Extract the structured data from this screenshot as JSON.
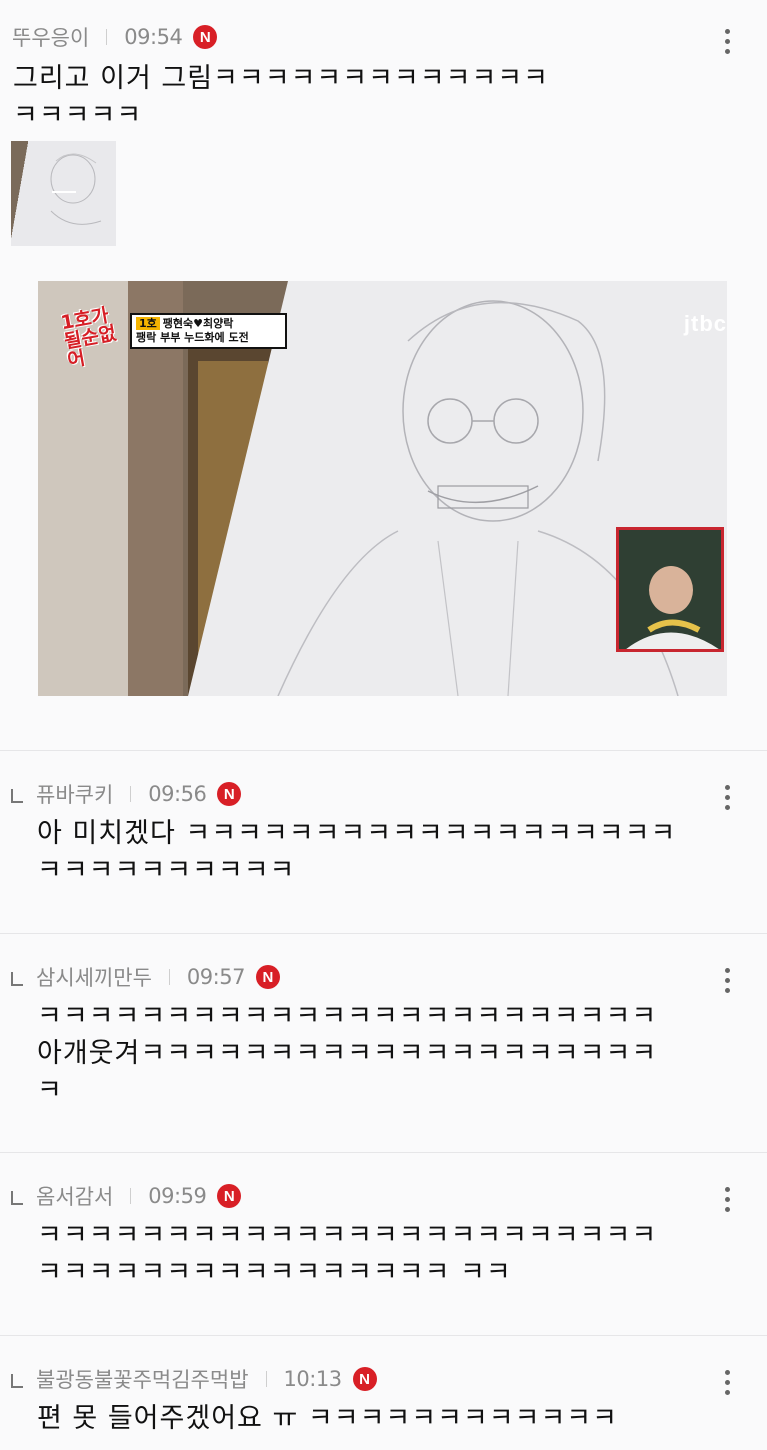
{
  "comments": [
    {
      "author": "뚜우응이",
      "time": "09:54",
      "badge": "N",
      "text": "그리고 이거 그림ㅋㅋㅋㅋㅋㅋㅋㅋㅋㅋㅋㅋㅋ\nㅋㅋㅋㅋㅋ",
      "reply": false
    },
    {
      "author": "퓨바쿠키",
      "time": "09:56",
      "badge": "N",
      "text": "아 미치겠다 ㅋㅋㅋㅋㅋㅋㅋㅋㅋㅋㅋㅋㅋㅋㅋㅋㅋㅋㅋ\nㅋㅋㅋㅋㅋㅋㅋㅋㅋㅋ",
      "reply": true
    },
    {
      "author": "삼시세끼만두",
      "time": "09:57",
      "badge": "N",
      "text": "ㅋㅋㅋㅋㅋㅋㅋㅋㅋㅋㅋㅋㅋㅋㅋㅋㅋㅋㅋㅋㅋㅋㅋㅋ\n아개웃겨ㅋㅋㅋㅋㅋㅋㅋㅋㅋㅋㅋㅋㅋㅋㅋㅋㅋㅋㅋㅋ\nㅋ",
      "reply": true
    },
    {
      "author": "옴서감서",
      "time": "09:59",
      "badge": "N",
      "text": "ㅋㅋㅋㅋㅋㅋㅋㅋㅋㅋㅋㅋㅋㅋㅋㅋㅋㅋㅋㅋㅋㅋㅋㅋ\nㅋㅋㅋㅋㅋㅋㅋㅋㅋㅋㅋㅋㅋㅋㅋㅋ ㅋㅋ",
      "reply": true
    },
    {
      "author": "불광동불꽃주먹김주먹밥",
      "time": "10:13",
      "badge": "N",
      "text": "편 못 들어주겠어요 ㅠ ㅋㅋㅋㅋㅋㅋㅋㅋㅋㅋㅋㅋ",
      "reply": true
    }
  ],
  "image": {
    "show_logo": "1호가 될순없어",
    "episode_num": "1호",
    "caption_line1": "팽현숙♥최양락",
    "caption_line2": "팽락 부부 누드화에 도전",
    "channel": "jtbc"
  },
  "colors": {
    "badge": "#d81f26",
    "meta_text": "#8a8a8a",
    "body_text": "#111111",
    "background": "#fafafb",
    "divider": "#e6e6e8"
  },
  "icons": [
    "more-vertical-icon",
    "reply-arrow-icon",
    "new-badge-icon"
  ]
}
